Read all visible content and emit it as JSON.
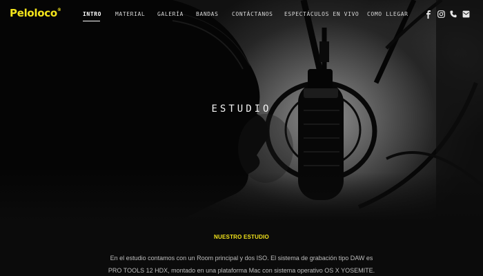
{
  "brand": {
    "name": "Peloloco",
    "mark": "®",
    "color": "#f3e41b"
  },
  "nav": {
    "items": [
      {
        "label": "INTRO",
        "active": true
      },
      {
        "label": "MATERIAL",
        "active": false
      },
      {
        "label": "GALERÍA",
        "active": false
      },
      {
        "label": "BANDAS",
        "active": false
      },
      {
        "label": "CONTÁCTANOS",
        "active": false
      },
      {
        "label": "ESPECTÁCULOS EN VIVO",
        "active": false
      },
      {
        "label": "COMO LLEGAR",
        "active": false
      }
    ],
    "social": [
      "facebook-icon",
      "instagram-icon",
      "phone-icon",
      "email-icon"
    ]
  },
  "hero": {
    "title": "ESTUDIO"
  },
  "section": {
    "heading": "NUESTRO ESTUDIO",
    "paragraph_lines": [
      "En el estudio contamos con un Room principal y dos ISO. El sistema de grabación tipo DAW es",
      "PRO TOOLS 12 HDX, montado en una plataforma Mac con sistema operativo OS X YOSEMITE."
    ]
  },
  "colors": {
    "accent": "#f3e41b",
    "background": "#0b0b0b",
    "text": "#bdbdbd"
  }
}
